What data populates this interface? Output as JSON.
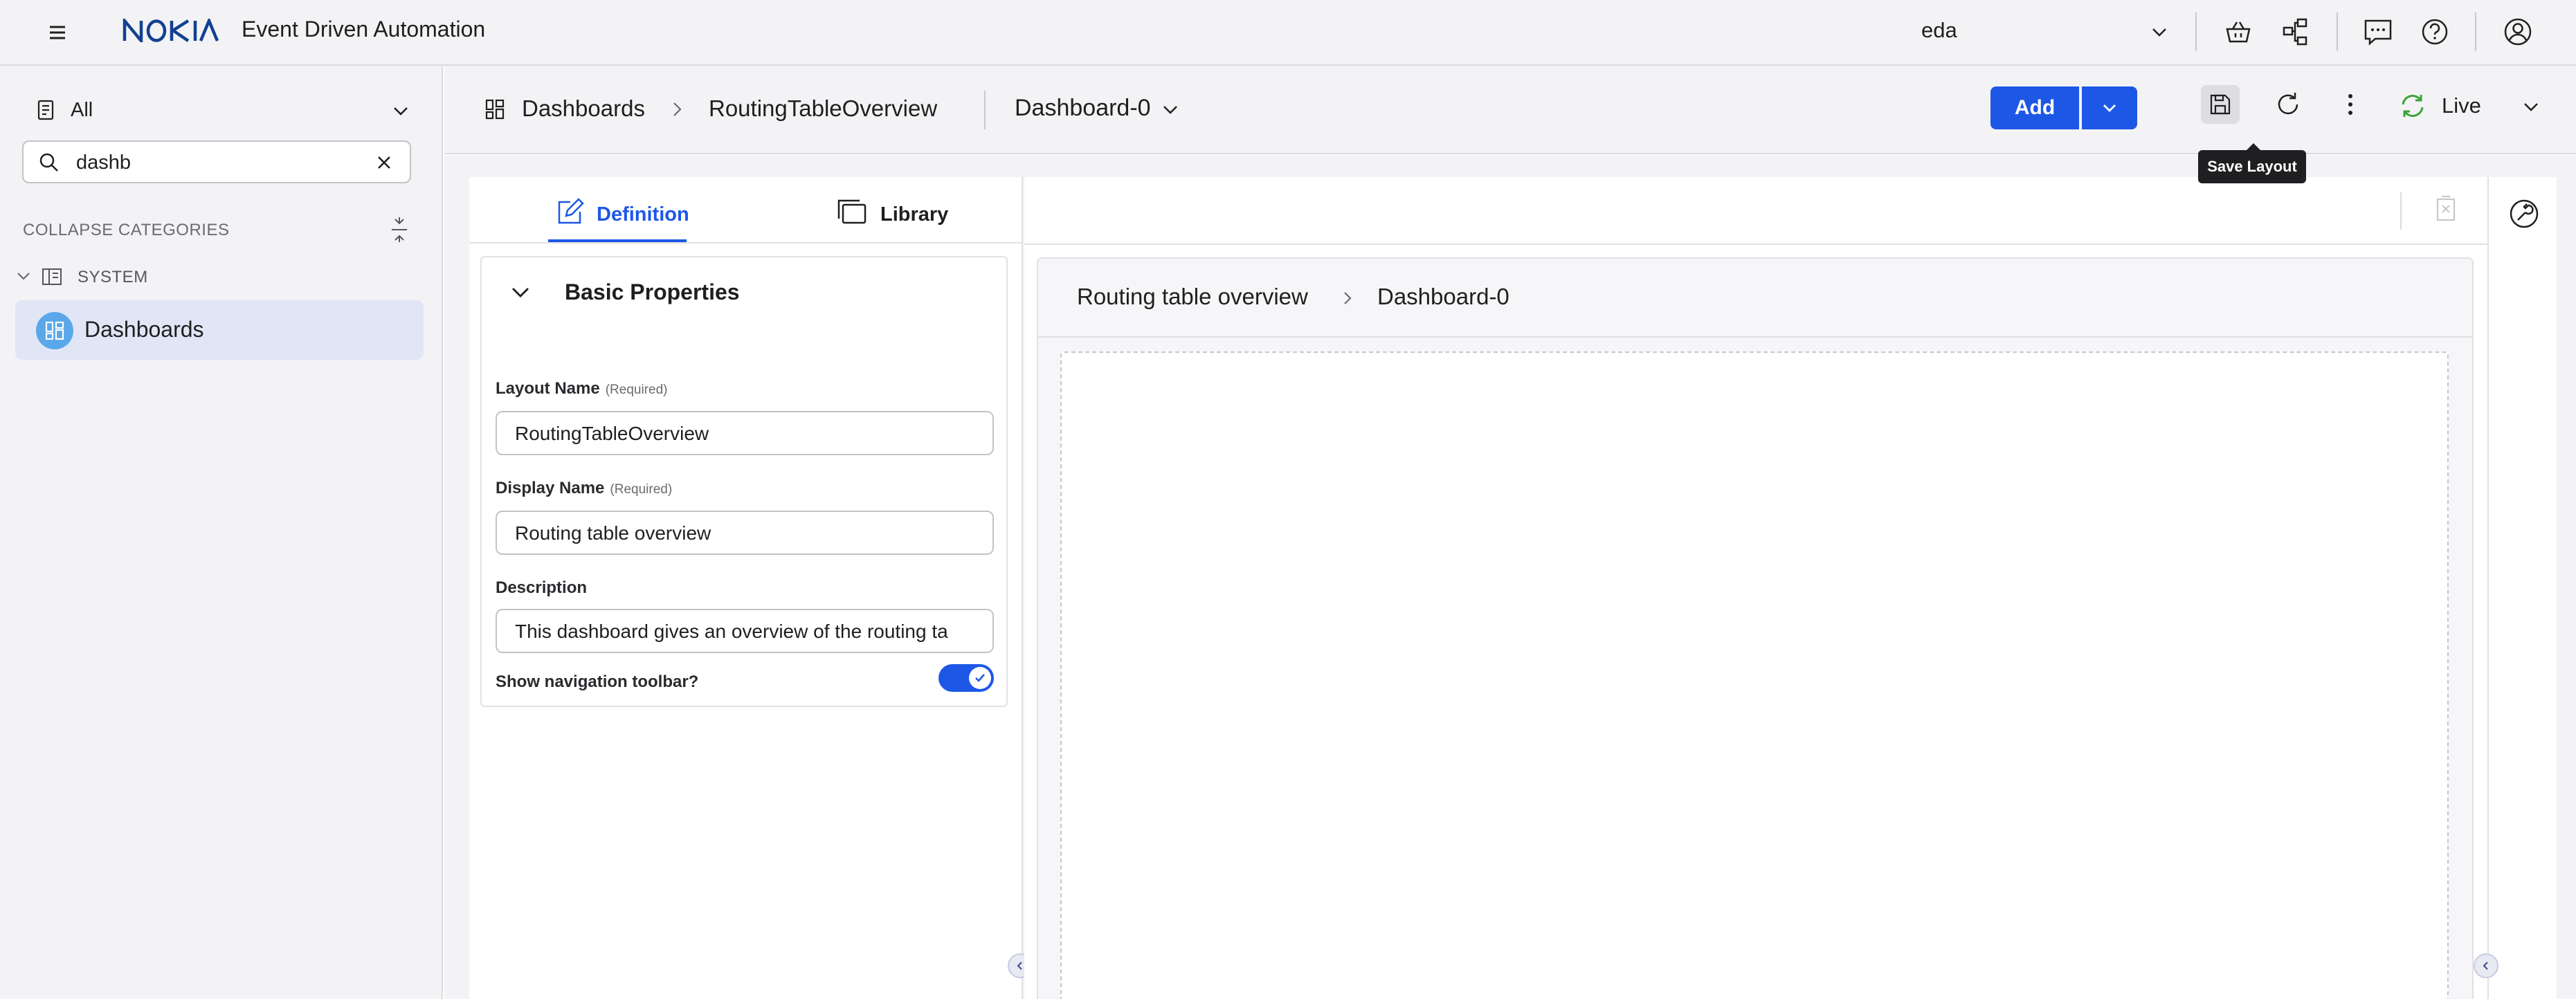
{
  "topbar": {
    "brand": "NOKIA",
    "app_title": "Event Driven Automation",
    "namespace": "eda",
    "icons": [
      "menu-icon",
      "basket-icon",
      "topology-icon",
      "chat-icon",
      "help-icon",
      "user-icon"
    ]
  },
  "sidebar": {
    "category_filter": "All",
    "search_value": "dashb",
    "collapse_label": "COLLAPSE CATEGORIES",
    "group_label": "SYSTEM",
    "items": [
      {
        "label": "Dashboards",
        "selected": true
      }
    ]
  },
  "header": {
    "breadcrumb": [
      "Dashboards",
      "RoutingTableOverview"
    ],
    "dashboard_select": "Dashboard-0",
    "add_label": "Add",
    "live_label": "Live",
    "tooltip": "Save Layout"
  },
  "editor": {
    "tabs": [
      {
        "label": "Definition",
        "active": true
      },
      {
        "label": "Library",
        "active": false
      }
    ],
    "section_title": "Basic Properties",
    "required_tag": "(Required)",
    "fields": {
      "layout_name": {
        "label": "Layout Name",
        "value": "RoutingTableOverview"
      },
      "display_name": {
        "label": "Display Name",
        "value": "Routing table overview"
      },
      "description": {
        "label": "Description",
        "value": "This dashboard gives an overview of the routing ta"
      }
    },
    "toggle": {
      "label": "Show navigation toolbar?",
      "checked": true
    }
  },
  "canvas": {
    "breadcrumb": [
      "Routing table overview",
      "Dashboard-0"
    ]
  },
  "colors": {
    "accent": "#1d57e6",
    "live_green": "#3aa335",
    "nav_selected_bg": "#e1e6f7",
    "logo_blue": "#124191"
  }
}
